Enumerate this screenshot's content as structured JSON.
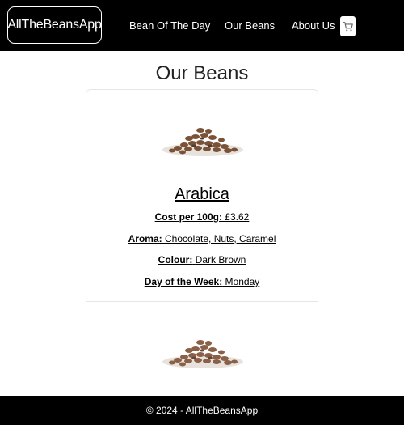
{
  "navbar": {
    "brand": "AllTheBeansApp",
    "links": [
      "Bean Of The Day",
      "Our Beans",
      "About Us"
    ],
    "cart_icon": "shopping-cart-icon"
  },
  "page": {
    "title": "Our Beans"
  },
  "beans": [
    {
      "name": "Arabica",
      "cost_label": "Cost per 100g:",
      "cost_value": "£3.62",
      "aroma_label": "Aroma:",
      "aroma_value": "Chocolate, Nuts, Caramel",
      "colour_label": "Colour:",
      "colour_value": "Dark Brown",
      "day_label": "Day of the Week:",
      "day_value": "Monday"
    }
  ],
  "footer": {
    "text": "© 2024 - AllTheBeansApp"
  },
  "colors": {
    "nav_bg": "#000000",
    "footer_bg": "#000000",
    "bean": "#7a5238"
  }
}
